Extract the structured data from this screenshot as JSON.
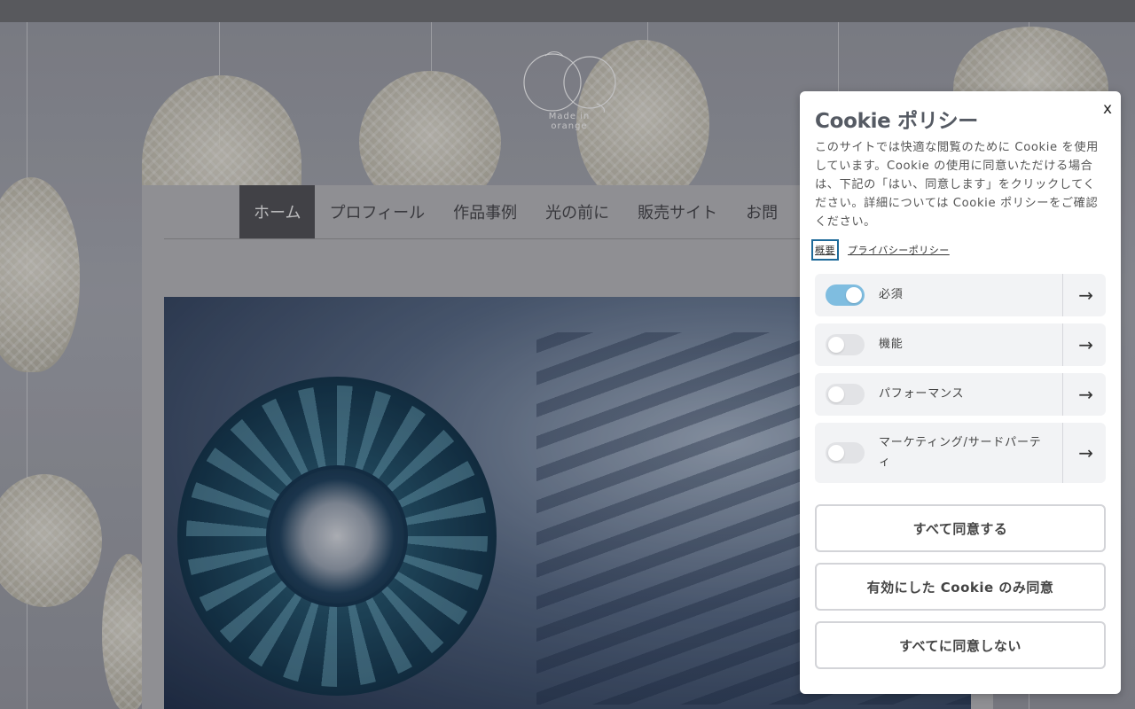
{
  "site": {
    "logo_text": "Made in orange",
    "nav": [
      "ホーム",
      "プロフィール",
      "作品事例",
      "光の前に",
      "販売サイト",
      "お問"
    ]
  },
  "cookie": {
    "close_label": "x",
    "title": "Cookie ポリシー",
    "description": "このサイトでは快適な閲覧のために Cookie を使用しています。Cookie の使用に同意いただける場合は、下記の「はい、同意します」をクリックしてください。詳細については Cookie ポリシーをご確認ください。",
    "links": {
      "overview": "概要",
      "privacy": "プライバシーポリシー"
    },
    "categories": [
      {
        "label": "必須",
        "enabled": true
      },
      {
        "label": "機能",
        "enabled": false
      },
      {
        "label": "パフォーマンス",
        "enabled": false
      },
      {
        "label": "マーケティング/サードパーティ",
        "enabled": false
      }
    ],
    "arrow_glyph": "→",
    "buttons": {
      "accept_all": "すべて同意する",
      "accept_selected": "有効にした Cookie のみ同意",
      "reject_all": "すべてに同意しない"
    }
  },
  "colors": {
    "toggle_on": "#7fbde0",
    "toggle_off": "#e2e3e6",
    "focus_outline": "#1e6a9a"
  }
}
